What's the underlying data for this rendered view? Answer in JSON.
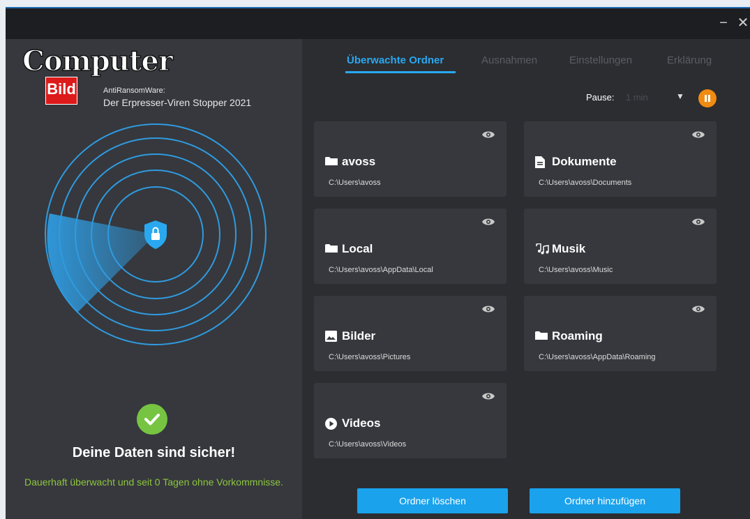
{
  "window": {
    "minimize_glyph": "−",
    "close_glyph": "✕"
  },
  "brand": {
    "logo_word": "Computer",
    "logo_bild": "Bild",
    "product_line1": "AntiRansomWare:",
    "product_line2": "Der Erpresser-Viren Stopper 2021"
  },
  "status": {
    "title": "Deine Daten sind sicher!",
    "subtitle": "Dauerhaft überwacht und seit 0 Tagen ohne Vorkommnisse.",
    "color": "#8dc63f"
  },
  "tabs": [
    {
      "label": "Überwachte Ordner",
      "active": true
    },
    {
      "label": "Ausnahmen",
      "active": false
    },
    {
      "label": "Einstellungen",
      "active": false
    },
    {
      "label": "Erklärung",
      "active": false
    }
  ],
  "pause": {
    "label": "Pause:",
    "value": "1 min"
  },
  "folders": [
    {
      "name": "avoss",
      "path": "C:\\Users\\avoss",
      "icon": "folder-icon"
    },
    {
      "name": "Dokumente",
      "path": "C:\\Users\\avoss\\Documents",
      "icon": "document-icon"
    },
    {
      "name": "Local",
      "path": "C:\\Users\\avoss\\AppData\\Local",
      "icon": "folder-icon"
    },
    {
      "name": "Musik",
      "path": "C:\\Users\\avoss\\Music",
      "icon": "music-icon"
    },
    {
      "name": "Bilder",
      "path": "C:\\Users\\avoss\\Pictures",
      "icon": "image-icon"
    },
    {
      "name": "Roaming",
      "path": "C:\\Users\\avoss\\AppData\\Roaming",
      "icon": "folder-icon"
    },
    {
      "name": "Videos",
      "path": "C:\\Users\\avoss\\Videos",
      "icon": "play-icon"
    }
  ],
  "buttons": {
    "delete": "Ordner löschen",
    "add": "Ordner hinzufügen"
  },
  "colors": {
    "accent": "#29a8f0",
    "pause": "#f08c12",
    "radar": "#2f9be0"
  }
}
